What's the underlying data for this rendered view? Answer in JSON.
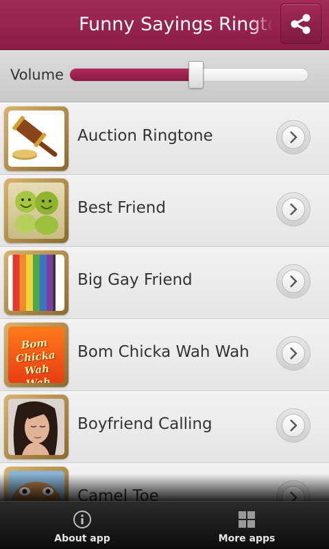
{
  "header": {
    "title": "Funny Sayings Ringtones",
    "share_icon": "share-icon",
    "accent_color": "#8c1d45"
  },
  "volume": {
    "label": "Volume",
    "level_percent": 53
  },
  "list": {
    "items": [
      {
        "label": "Auction Ringtone",
        "thumbnail": "gavel-image"
      },
      {
        "label": "Best Friend",
        "thumbnail": "green-figures-image"
      },
      {
        "label": "Big Gay Friend",
        "thumbnail": "rainbow-stripes-image"
      },
      {
        "label": "Bom Chicka Wah Wah",
        "thumbnail": "bom-chicka-logo-image",
        "thumbnail_text": "Bom Chicka Wah Wah"
      },
      {
        "label": "Boyfriend Calling",
        "thumbnail": "bored-woman-image"
      },
      {
        "label": "Camel Toe",
        "thumbnail": "camel-image"
      }
    ]
  },
  "bottom_bar": {
    "about_label": "About app",
    "about_icon": "info-icon",
    "more_label": "More apps",
    "more_icon": "grid-icon"
  }
}
